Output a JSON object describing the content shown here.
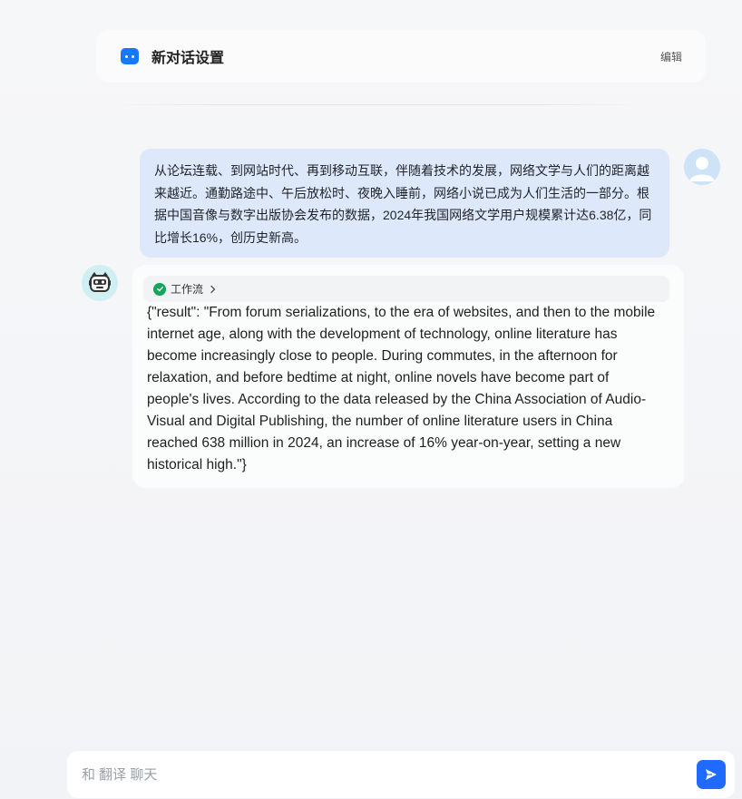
{
  "header": {
    "title": "新对话设置",
    "edit_label": "编辑",
    "accent": "#1677ff"
  },
  "user_message": {
    "text": "从论坛连载、到网站时代、再到移动互联，伴随着技术的发展，网络文学与人们的距离越来越近。通勤路途中、午后放松时、夜晚入睡前，网络小说已成为人们生活的一部分。根据中国音像与数字出版协会发布的数据，2024年我国网络文学用户规模累计达6.38亿，同比增长16%，创历史新高。",
    "avatar_icon": "user-avatar-icon"
  },
  "bot_message": {
    "avatar_icon": "robot-avatar-icon",
    "workflow_label": "工作流",
    "workflow_status_icon": "check-circle-icon",
    "text": "{\"result\": \"From forum serializations, to the era of websites, and then to the mobile internet age, along with the development of technology, online literature has become increasingly close to people. During commutes, in the afternoon for relaxation, and before bedtime at night, online novels have become part of people's lives. According to the data released by the China Association of Audio-Visual and Digital Publishing, the number of online literature users in China reached 638 million in 2024, an increase of 16% year-on-year, setting a new historical high.\"}"
  },
  "input": {
    "placeholder": "和 翻译 聊天",
    "value": "",
    "send_icon": "send-icon",
    "send_color": "#1f6bff"
  }
}
